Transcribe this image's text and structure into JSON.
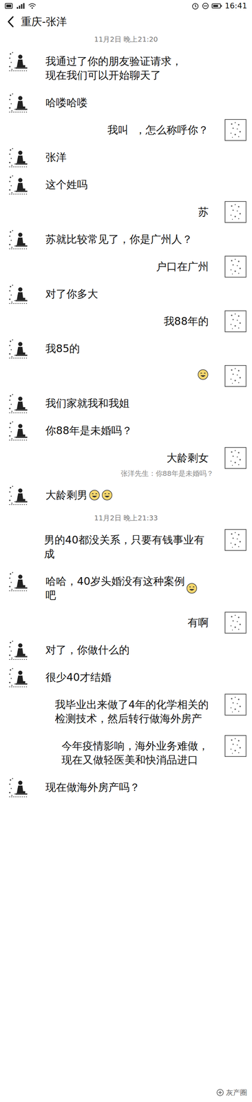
{
  "status_bar": {
    "time": "16:41"
  },
  "header": {
    "title": "重庆-张洋"
  },
  "messages": [
    {
      "kind": "time",
      "text": "11月2日 晚上21:20"
    },
    {
      "kind": "incoming",
      "text": "我通过了你的朋友验证请求，\n现在我们可以开始聊天了",
      "emoji": 0
    },
    {
      "kind": "incoming",
      "text": "哈喽哈喽",
      "emoji": 0
    },
    {
      "kind": "outgoing",
      "text": "我叫  ，怎么称呼你？",
      "emoji": 0
    },
    {
      "kind": "incoming",
      "text": "张洋",
      "emoji": 0
    },
    {
      "kind": "incoming",
      "text": "这个姓吗",
      "emoji": 0
    },
    {
      "kind": "outgoing",
      "text": "苏",
      "emoji": 0
    },
    {
      "kind": "incoming",
      "text": "苏就比较常见了，你是广州人？",
      "emoji": 0
    },
    {
      "kind": "outgoing",
      "text": "户口在广州",
      "emoji": 0
    },
    {
      "kind": "incoming",
      "text": "对了你多大",
      "emoji": 0
    },
    {
      "kind": "outgoing",
      "text": "我88年的",
      "emoji": 0
    },
    {
      "kind": "incoming",
      "text": "我85的",
      "emoji": 0
    },
    {
      "kind": "outgoing",
      "text": "",
      "emoji": 1
    },
    {
      "kind": "incoming",
      "text": "我们家就我和我姐",
      "emoji": 0
    },
    {
      "kind": "incoming",
      "text": "你88年是未婚吗？",
      "emoji": 0
    },
    {
      "kind": "outgoing",
      "text": "大龄剩女",
      "emoji": 0,
      "quote": "张洋先生：你88年是未婚吗？"
    },
    {
      "kind": "incoming",
      "text": "大龄剩男",
      "emoji": 2
    },
    {
      "kind": "time",
      "text": "11月2日 晚上21:33"
    },
    {
      "kind": "outgoing",
      "text": "男的40都没关系，只要有钱事业有成",
      "emoji": 0
    },
    {
      "kind": "incoming",
      "text": "哈哈，40岁头婚没有这种案例\n吧",
      "emoji": 1
    },
    {
      "kind": "outgoing",
      "text": "有啊",
      "emoji": 0
    },
    {
      "kind": "incoming",
      "text": "对了，你做什么的",
      "emoji": 0
    },
    {
      "kind": "incoming",
      "text": "很少40才结婚",
      "emoji": 0
    },
    {
      "kind": "outgoing",
      "text": "我毕业出来做了4年的化学相关的\n检测技术，然后转行做海外房产",
      "emoji": 0
    },
    {
      "kind": "outgoing",
      "text": "今年疫情影响，海外业务难做，\n现在又做轻医美和快消品进口",
      "emoji": 0
    },
    {
      "kind": "incoming",
      "text": "现在做海外房产吗？",
      "emoji": 0
    }
  ],
  "watermark": "灰产圈"
}
